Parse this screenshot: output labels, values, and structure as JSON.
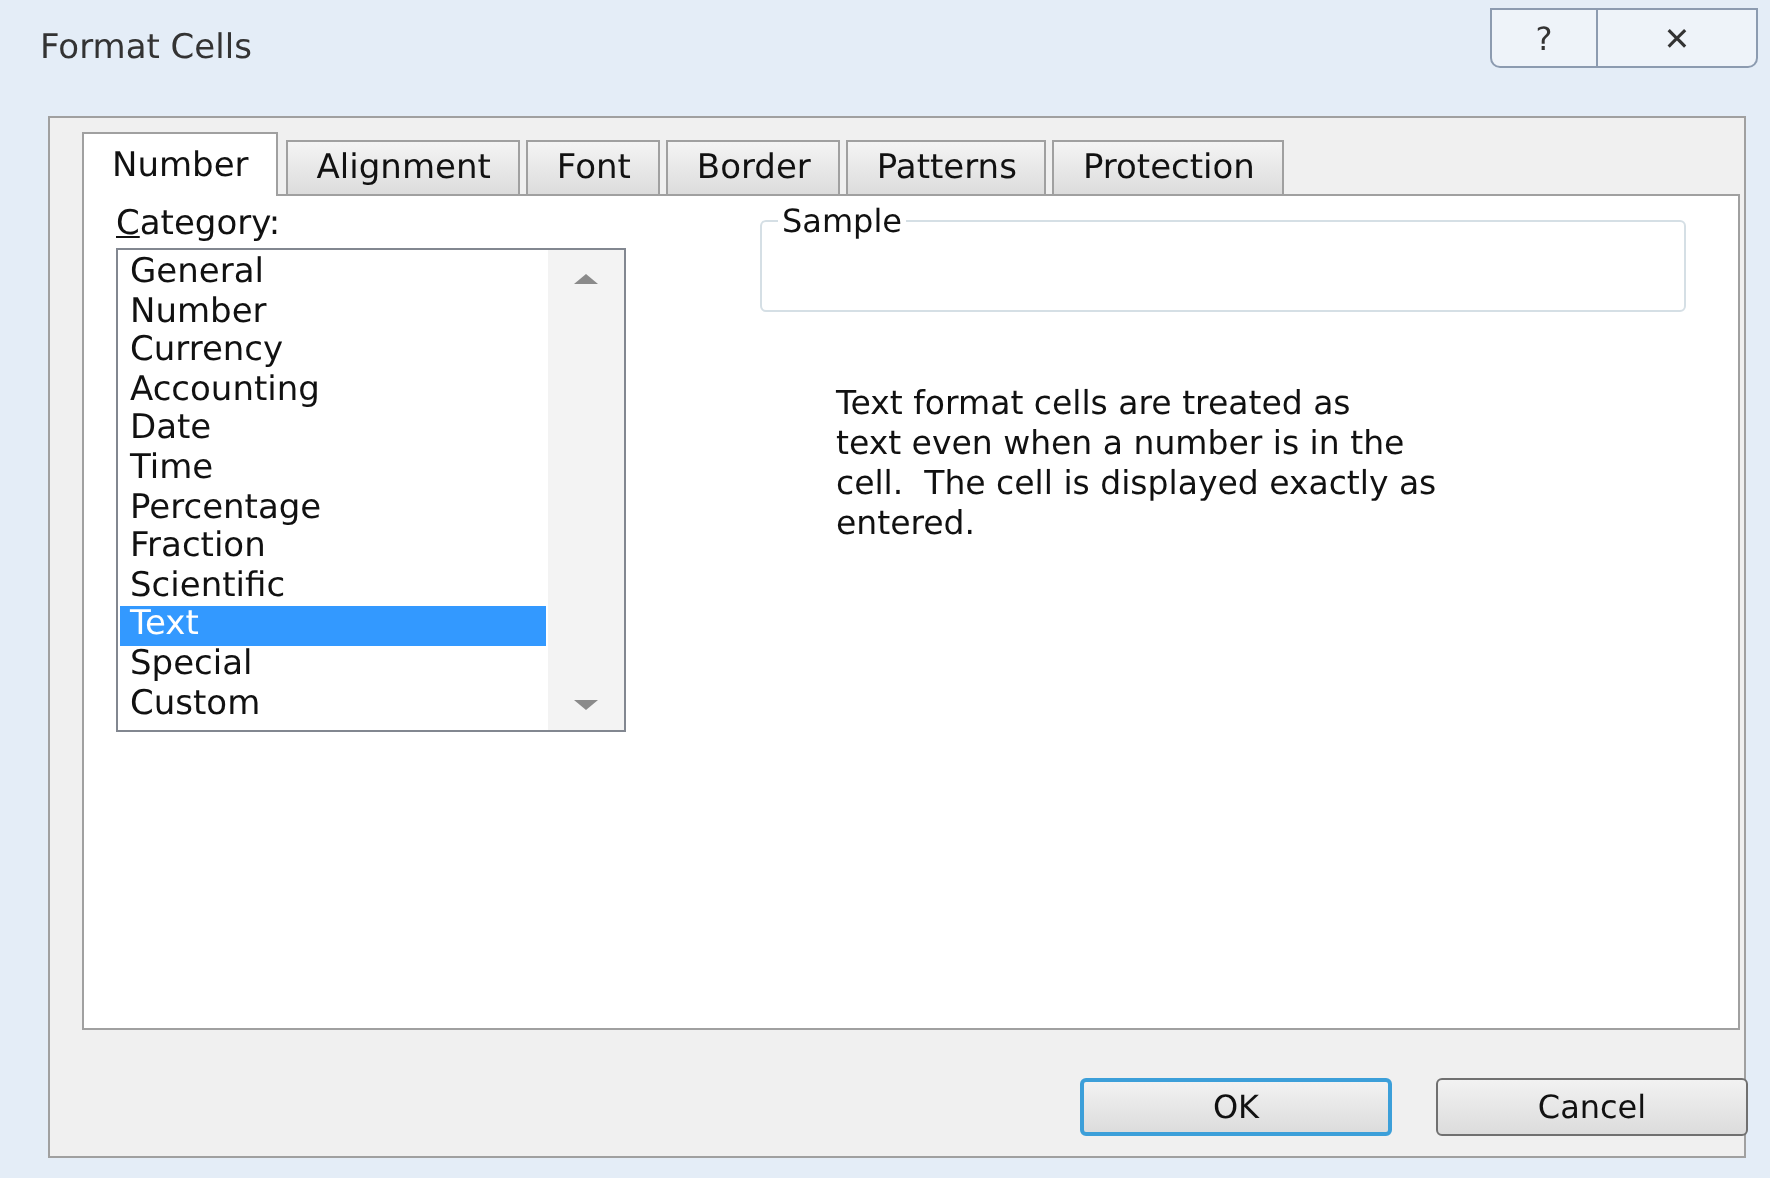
{
  "window": {
    "title": "Format Cells",
    "help": "?",
    "close": "✕"
  },
  "tabs": [
    {
      "label": "Number",
      "selected": true
    },
    {
      "label": "Alignment",
      "selected": false
    },
    {
      "label": "Font",
      "selected": false
    },
    {
      "label": "Border",
      "selected": false
    },
    {
      "label": "Patterns",
      "selected": false
    },
    {
      "label": "Protection",
      "selected": false
    }
  ],
  "category": {
    "label": "Category:",
    "items": [
      {
        "label": "General",
        "selected": false
      },
      {
        "label": "Number",
        "selected": false
      },
      {
        "label": "Currency",
        "selected": false
      },
      {
        "label": "Accounting",
        "selected": false
      },
      {
        "label": "Date",
        "selected": false
      },
      {
        "label": "Time",
        "selected": false
      },
      {
        "label": "Percentage",
        "selected": false
      },
      {
        "label": "Fraction",
        "selected": false
      },
      {
        "label": "Scientific",
        "selected": false
      },
      {
        "label": "Text",
        "selected": true
      },
      {
        "label": "Special",
        "selected": false
      },
      {
        "label": "Custom",
        "selected": false
      }
    ]
  },
  "sample": {
    "label": "Sample"
  },
  "description": "Text format cells are treated as\ntext even when a number is in the\ncell.  The cell is displayed exactly as\nentered.",
  "buttons": [
    {
      "label": "OK",
      "kind": "default"
    },
    {
      "label": "Cancel",
      "kind": "normal"
    }
  ]
}
